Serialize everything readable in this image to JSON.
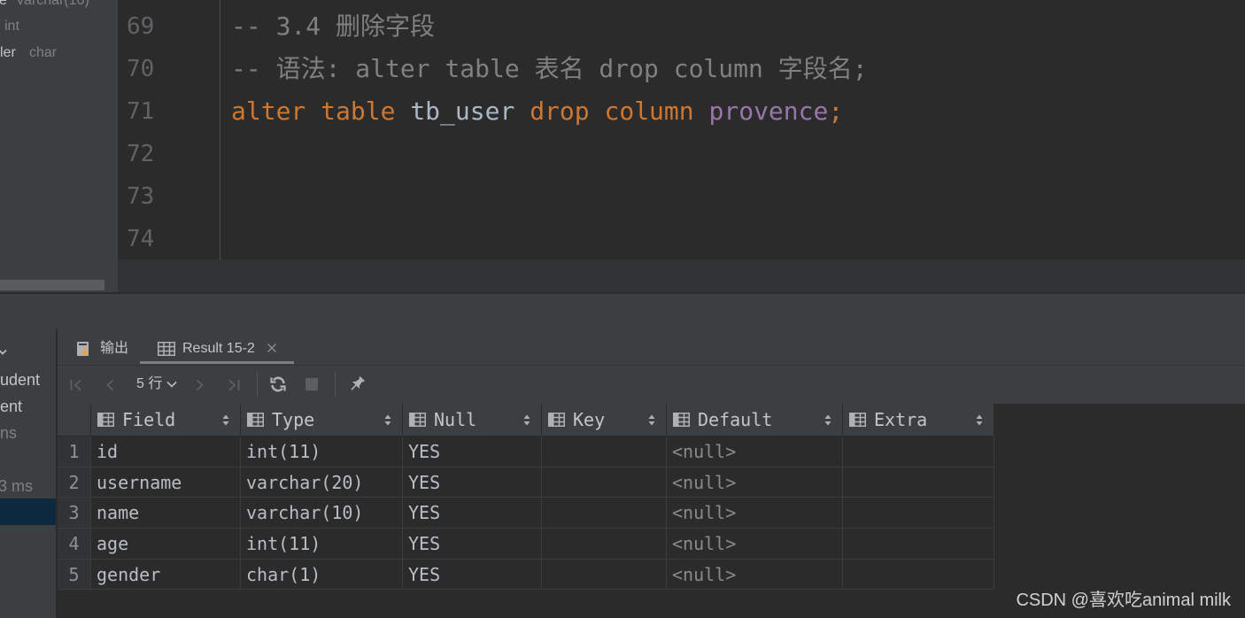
{
  "theme": {
    "panel": "#3c3f41",
    "editor": "#2b2b2b",
    "selection": "#0d293e",
    "line_number": "#606366"
  },
  "structure": {
    "columns": [
      {
        "name": "e",
        "type": "varchar(10)"
      },
      {
        "name": "",
        "type": "int"
      },
      {
        "name": "ler",
        "type": "char"
      }
    ]
  },
  "editor": {
    "lines": [
      {
        "number": "69",
        "tokens": [
          {
            "text": "-- 3.4 删除字段",
            "color": "#808080"
          }
        ]
      },
      {
        "number": "70",
        "tokens": [
          {
            "text": "-- 语法: alter table 表名 drop column 字段名;",
            "color": "#808080"
          }
        ]
      },
      {
        "number": "71",
        "tokens": [
          {
            "text": "alter",
            "color": "#cc7832"
          },
          {
            "text": "table",
            "color": "#cc7832"
          },
          {
            "text": "tb_user",
            "color": "#a9b7c6"
          },
          {
            "text": "drop",
            "color": "#cc7832"
          },
          {
            "text": "column",
            "color": "#cc7832"
          },
          {
            "text": "provence",
            "color": "#9876aa"
          },
          {
            "text": ";",
            "color": "#cc7832"
          }
        ]
      },
      {
        "number": "72",
        "tokens": []
      },
      {
        "number": "73",
        "tokens": []
      },
      {
        "number": "74",
        "tokens": []
      }
    ]
  },
  "services": {
    "icon": "chevron-down-icon",
    "items": [
      {
        "text": "udent"
      },
      {
        "text": "ent"
      },
      {
        "text": "ns"
      },
      {
        "text": "3 ms"
      }
    ]
  },
  "results": {
    "tabs": [
      {
        "label": "输出",
        "icon": "console-output-icon",
        "active": false
      },
      {
        "label": "Result 15-2",
        "icon": "table-icon",
        "active": true,
        "close_icon": "close-icon"
      }
    ],
    "toolbar": {
      "page_size": "5 行",
      "icons": [
        "first-page-icon",
        "previous-page-icon",
        "chevron-down-icon",
        "next-page-icon",
        "last-page-icon",
        "refresh-icon",
        "stop-icon",
        "pin-icon"
      ]
    },
    "columns": [
      "Field",
      "Type",
      "Null",
      "Key",
      "Default",
      "Extra"
    ],
    "rows": [
      {
        "n": "1",
        "cells": [
          "id",
          "int(11)",
          "YES",
          "",
          "<null>",
          ""
        ]
      },
      {
        "n": "2",
        "cells": [
          "username",
          "varchar(20)",
          "YES",
          "",
          "<null>",
          ""
        ]
      },
      {
        "n": "3",
        "cells": [
          "name",
          "varchar(10)",
          "YES",
          "",
          "<null>",
          ""
        ]
      },
      {
        "n": "4",
        "cells": [
          "age",
          "int(11)",
          "YES",
          "",
          "<null>",
          ""
        ]
      },
      {
        "n": "5",
        "cells": [
          "gender",
          "char(1)",
          "YES",
          "",
          "<null>",
          ""
        ]
      }
    ]
  },
  "watermark": "CSDN @喜欢吃animal milk"
}
